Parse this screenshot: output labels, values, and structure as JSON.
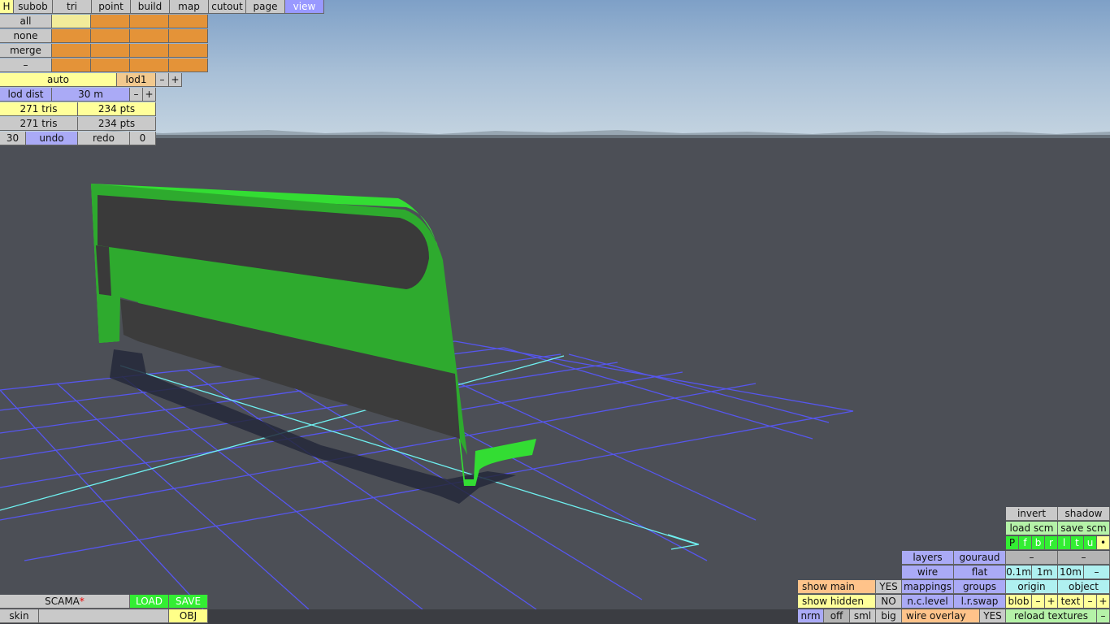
{
  "tabs": [
    "H",
    "subob",
    "tri",
    "point",
    "build",
    "map",
    "cutout",
    "page",
    "view"
  ],
  "select": {
    "all": "all",
    "none": "none",
    "merge": "merge",
    "minus": "–"
  },
  "lod": {
    "auto": "auto",
    "lod1": "lod1",
    "minus": "–",
    "plus": "+",
    "dist_label": "lod dist",
    "dist_value": "30 m"
  },
  "stats": {
    "tris1": "271 tris",
    "pts1": "234 pts",
    "tris2": "271 tris",
    "pts2": "234 pts"
  },
  "history": {
    "count": "30",
    "undo": "undo",
    "redo": "redo",
    "redo_count": "0"
  },
  "bottom_left": {
    "file": "SCAMA",
    "file_mark": "*",
    "load": "LOAD",
    "save": "SAVE",
    "skin": "skin",
    "skin_value": "",
    "obj": "OBJ"
  },
  "right_panel": {
    "invert": "invert",
    "shadow": "shadow",
    "load_scm": "load scm",
    "save_scm": "save scm",
    "views": [
      "P",
      "f",
      "b",
      "r",
      "l",
      "t",
      "u",
      "•"
    ],
    "layers": "layers",
    "gouraud": "gouraud",
    "dash1": "–",
    "dash2": "–",
    "wire": "wire",
    "flat": "flat",
    "g01": "0.1m",
    "g1": "1m",
    "g10": "10m",
    "gminus": "–",
    "show_main": "show main",
    "show_main_val": "YES",
    "mappings": "mappings",
    "groups": "groups",
    "origin": "origin",
    "object": "object",
    "show_hidden": "show hidden",
    "show_hidden_val": "NO",
    "nclevel": "n.c.level",
    "lrswap": "l.r.swap",
    "blob": "blob",
    "blob_minus": "–",
    "blob_plus": "+",
    "text": "text",
    "text_minus": "–",
    "text_plus": "+",
    "nrm": "nrm",
    "off": "off",
    "sml": "sml",
    "big": "big",
    "wire_overlay": "wire overlay",
    "wire_overlay_val": "YES",
    "reload_textures": "reload textures",
    "reload_minus": "–"
  },
  "colors": {
    "model_green": "#2eaa2e",
    "model_edge": "#33dd33",
    "grid": "#5a5af0",
    "axis": "#6ff0f0"
  }
}
